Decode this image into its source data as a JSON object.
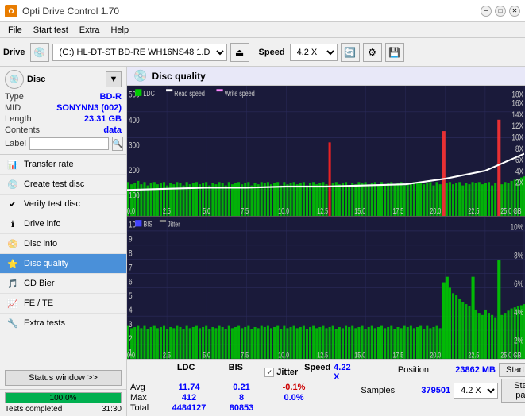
{
  "titleBar": {
    "title": "Opti Drive Control 1.70",
    "minBtn": "─",
    "maxBtn": "□",
    "closeBtn": "✕"
  },
  "menuBar": {
    "items": [
      "File",
      "Start test",
      "Extra",
      "Help"
    ]
  },
  "toolbar": {
    "driveLabel": "Drive",
    "driveValue": "(G:)  HL-DT-ST BD-RE  WH16NS48 1.D3",
    "speedLabel": "Speed",
    "speedValue": "4.2 X"
  },
  "disc": {
    "title": "Disc",
    "typeLabel": "Type",
    "typeValue": "BD-R",
    "midLabel": "MID",
    "midValue": "SONYNN3 (002)",
    "lengthLabel": "Length",
    "lengthValue": "23.31 GB",
    "contentsLabel": "Contents",
    "contentsValue": "data",
    "labelLabel": "Label",
    "labelValue": ""
  },
  "nav": {
    "items": [
      {
        "id": "transfer-rate",
        "label": "Transfer rate",
        "icon": "📊"
      },
      {
        "id": "create-test-disc",
        "label": "Create test disc",
        "icon": "💿"
      },
      {
        "id": "verify-test-disc",
        "label": "Verify test disc",
        "icon": "✔"
      },
      {
        "id": "drive-info",
        "label": "Drive info",
        "icon": "ℹ"
      },
      {
        "id": "disc-info",
        "label": "Disc info",
        "icon": "📀"
      },
      {
        "id": "disc-quality",
        "label": "Disc quality",
        "icon": "⭐",
        "active": true
      },
      {
        "id": "cd-bier",
        "label": "CD Bier",
        "icon": "🍺"
      },
      {
        "id": "fe-te",
        "label": "FE / TE",
        "icon": "📈"
      },
      {
        "id": "extra-tests",
        "label": "Extra tests",
        "icon": "🔧"
      }
    ]
  },
  "statusBtn": "Status window >>",
  "progress": {
    "value": 100,
    "text": "100.0%"
  },
  "statusText": "Tests completed",
  "timeText": "31:30",
  "chartHeader": {
    "title": "Disc quality",
    "legend": [
      "LDC",
      "Read speed",
      "Write speed"
    ]
  },
  "stats": {
    "headers": [
      "LDC",
      "BIS",
      "",
      "Jitter",
      "Speed",
      "4.22 X"
    ],
    "rows": [
      {
        "label": "Avg",
        "ldc": "11.74",
        "bis": "0.21",
        "jitter": "-0.1%"
      },
      {
        "label": "Max",
        "ldc": "412",
        "bis": "8",
        "jitter": "0.0%"
      },
      {
        "label": "Total",
        "ldc": "4484127",
        "bis": "80853",
        "jitter": ""
      }
    ],
    "position": {
      "label": "Position",
      "value": "23862 MB"
    },
    "samples": {
      "label": "Samples",
      "value": "379501"
    },
    "speedDropdown": "4.2 X",
    "startFull": "Start full",
    "startPart": "Start part"
  }
}
